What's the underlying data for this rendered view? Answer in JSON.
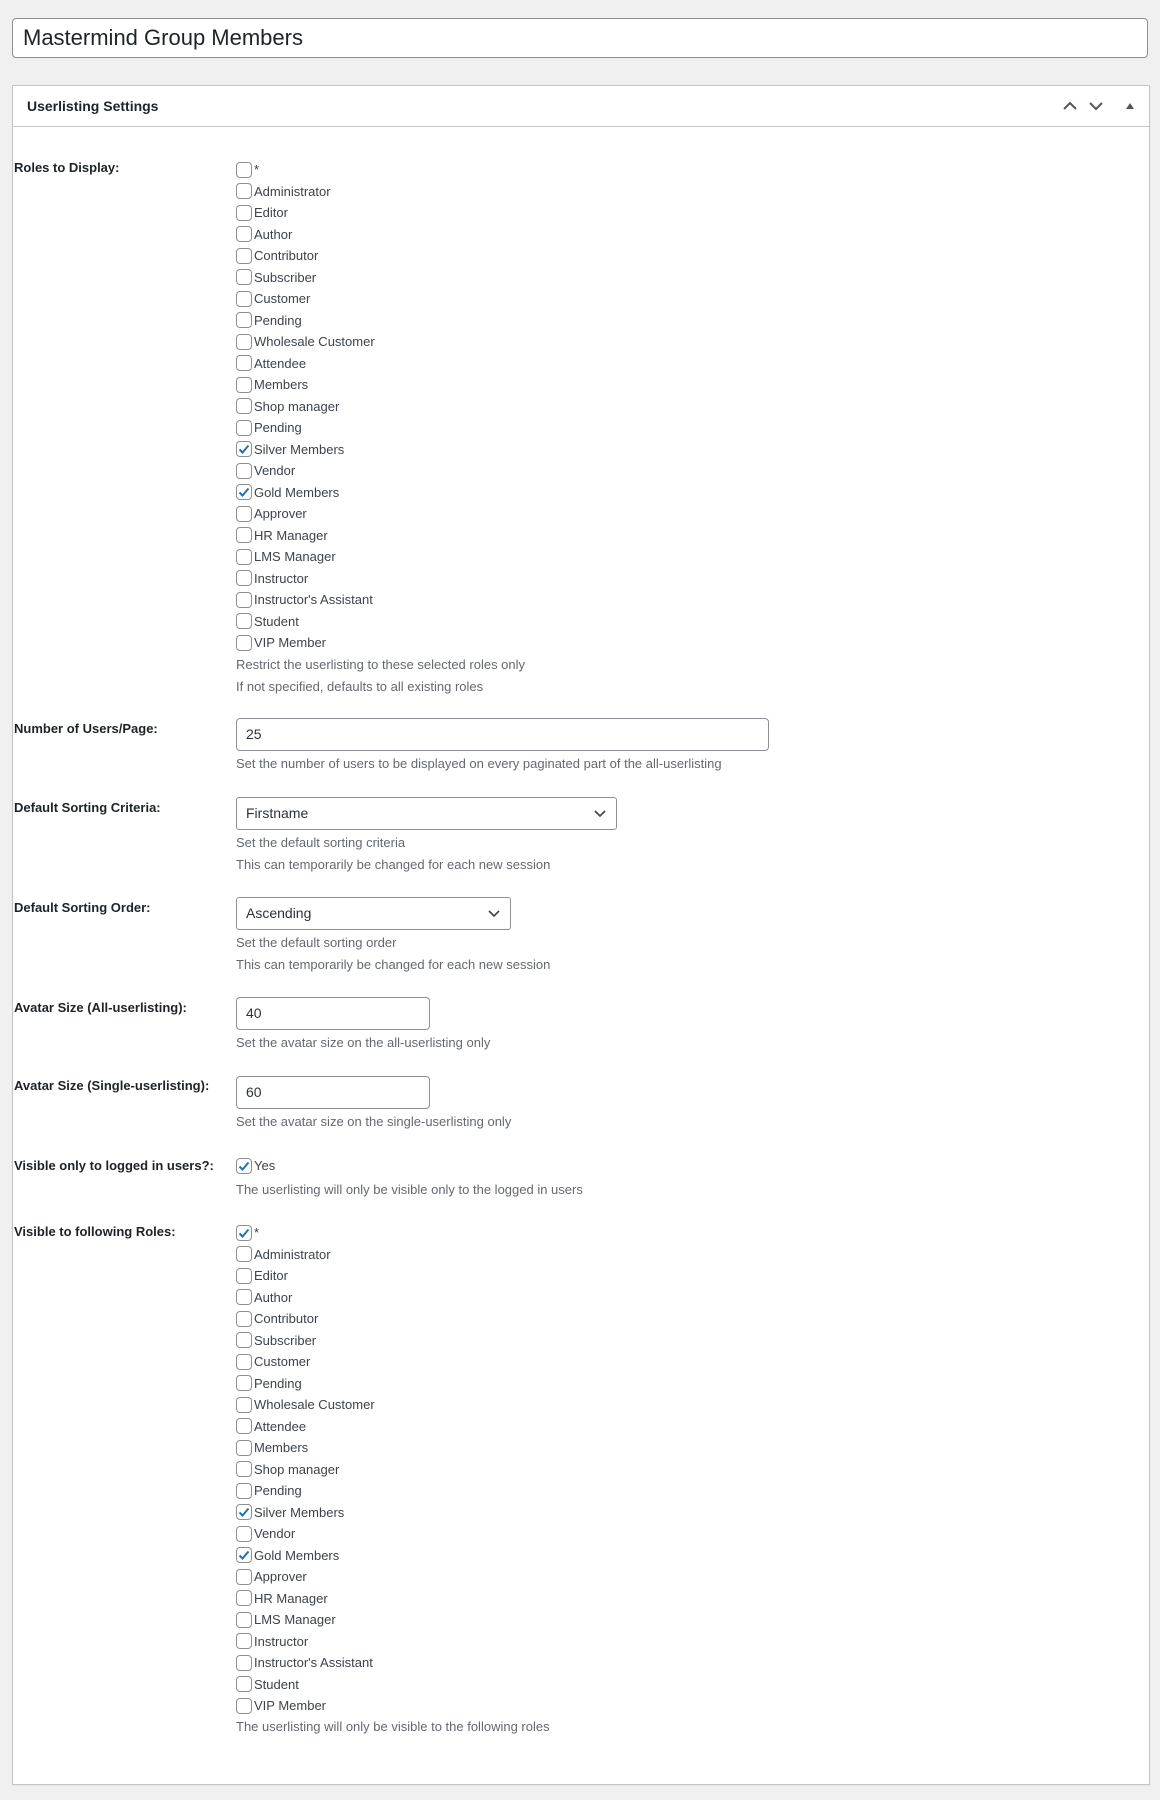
{
  "title": "Mastermind Group Members",
  "panel": {
    "title": "Userlisting Settings",
    "icons": [
      "chevron-up-icon",
      "chevron-down-icon",
      "triangle-up-icon"
    ]
  },
  "roles_to_display": {
    "label": "Roles to Display:",
    "options": [
      {
        "label": "*",
        "checked": false
      },
      {
        "label": "Administrator",
        "checked": false
      },
      {
        "label": "Editor",
        "checked": false
      },
      {
        "label": "Author",
        "checked": false
      },
      {
        "label": "Contributor",
        "checked": false
      },
      {
        "label": "Subscriber",
        "checked": false
      },
      {
        "label": "Customer",
        "checked": false
      },
      {
        "label": "Pending",
        "checked": false
      },
      {
        "label": "Wholesale Customer",
        "checked": false
      },
      {
        "label": "Attendee",
        "checked": false
      },
      {
        "label": "Members",
        "checked": false
      },
      {
        "label": "Shop manager",
        "checked": false
      },
      {
        "label": "Pending",
        "checked": false
      },
      {
        "label": "Silver Members",
        "checked": true
      },
      {
        "label": "Vendor",
        "checked": false
      },
      {
        "label": "Gold Members",
        "checked": true
      },
      {
        "label": "Approver",
        "checked": false
      },
      {
        "label": "HR Manager",
        "checked": false
      },
      {
        "label": "LMS Manager",
        "checked": false
      },
      {
        "label": "Instructor",
        "checked": false
      },
      {
        "label": "Instructor's Assistant",
        "checked": false
      },
      {
        "label": "Student",
        "checked": false
      },
      {
        "label": "VIP Member",
        "checked": false
      }
    ],
    "help": [
      "Restrict the userlisting to these selected roles only",
      "If not specified, defaults to all existing roles"
    ]
  },
  "users_per_page": {
    "label": "Number of Users/Page:",
    "value": "25",
    "help": [
      "Set the number of users to be displayed on every paginated part of the all-userlisting"
    ]
  },
  "sorting_criteria": {
    "label": "Default Sorting Criteria:",
    "value": "Firstname",
    "help": [
      "Set the default sorting criteria",
      "This can temporarily be changed for each new session"
    ]
  },
  "sorting_order": {
    "label": "Default Sorting Order:",
    "value": "Ascending",
    "help": [
      "Set the default sorting order",
      "This can temporarily be changed for each new session"
    ]
  },
  "avatar_all": {
    "label": "Avatar Size (All-userlisting):",
    "value": "40",
    "help": [
      "Set the avatar size on the all-userlisting only"
    ]
  },
  "avatar_single": {
    "label": "Avatar Size (Single-userlisting):",
    "value": "60",
    "help": [
      "Set the avatar size on the single-userlisting only"
    ]
  },
  "visible_logged_in": {
    "label": "Visible only to logged in users?:",
    "option": {
      "label": "Yes",
      "checked": true
    },
    "help": [
      "The userlisting will only be visible only to the logged in users"
    ]
  },
  "visible_roles": {
    "label": "Visible to following Roles:",
    "options": [
      {
        "label": "*",
        "checked": true
      },
      {
        "label": "Administrator",
        "checked": false
      },
      {
        "label": "Editor",
        "checked": false
      },
      {
        "label": "Author",
        "checked": false
      },
      {
        "label": "Contributor",
        "checked": false
      },
      {
        "label": "Subscriber",
        "checked": false
      },
      {
        "label": "Customer",
        "checked": false
      },
      {
        "label": "Pending",
        "checked": false
      },
      {
        "label": "Wholesale Customer",
        "checked": false
      },
      {
        "label": "Attendee",
        "checked": false
      },
      {
        "label": "Members",
        "checked": false
      },
      {
        "label": "Shop manager",
        "checked": false
      },
      {
        "label": "Pending",
        "checked": false
      },
      {
        "label": "Silver Members",
        "checked": true
      },
      {
        "label": "Vendor",
        "checked": false
      },
      {
        "label": "Gold Members",
        "checked": true
      },
      {
        "label": "Approver",
        "checked": false
      },
      {
        "label": "HR Manager",
        "checked": false
      },
      {
        "label": "LMS Manager",
        "checked": false
      },
      {
        "label": "Instructor",
        "checked": false
      },
      {
        "label": "Instructor's Assistant",
        "checked": false
      },
      {
        "label": "Student",
        "checked": false
      },
      {
        "label": "VIP Member",
        "checked": false
      }
    ],
    "help": [
      "The userlisting will only be visible to the following roles"
    ]
  },
  "colors": {
    "accent": "#2271b1",
    "background": "#f0f0f1",
    "border": "#8c8f94",
    "help_text": "#646970"
  }
}
